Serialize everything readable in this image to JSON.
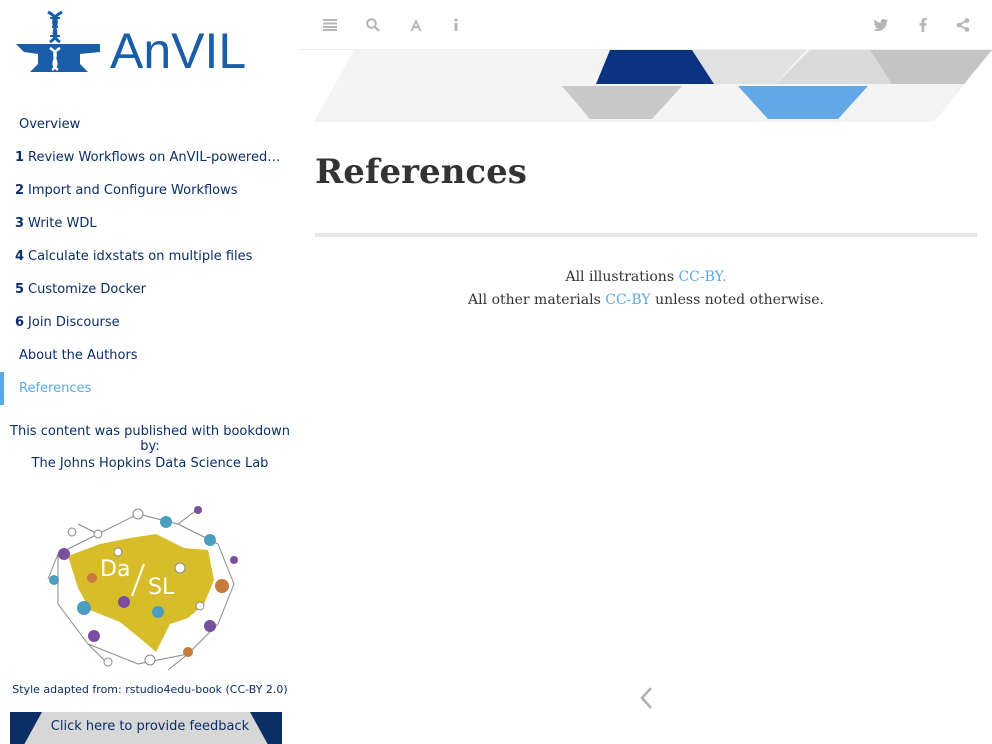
{
  "sidebar": {
    "logo_text": "AnVIL",
    "toc": [
      {
        "num": "",
        "label": "Overview"
      },
      {
        "num": "1",
        "label": "Review Workflows on AnVIL-powered-b…"
      },
      {
        "num": "2",
        "label": "Import and Configure Workflows"
      },
      {
        "num": "3",
        "label": "Write WDL"
      },
      {
        "num": "4",
        "label": "Calculate idxstats on multiple files"
      },
      {
        "num": "5",
        "label": "Customize Docker"
      },
      {
        "num": "6",
        "label": "Join Discourse"
      },
      {
        "num": "",
        "label": "About the Authors"
      },
      {
        "num": "",
        "label": "References"
      }
    ],
    "published_text": "This content was published with bookdown by:",
    "lab_name": "The Johns Hopkins Data Science Lab",
    "dasl_text": "DaSL",
    "style_adapted": "Style adapted from: rstudio4edu-book (CC-BY 2.0)",
    "feedback_text": "Click here to provide feedback"
  },
  "toolbar": {
    "icons": [
      "menu-icon",
      "search-icon",
      "font-icon",
      "info-icon",
      "twitter-icon",
      "facebook-icon",
      "share-icon"
    ]
  },
  "main": {
    "title": "References",
    "license_line1_prefix": "All illustrations ",
    "license_line1_link": "CC-BY.",
    "license_line2_prefix": "All other materials ",
    "license_line2_link": "CC-BY",
    "license_line2_suffix": " unless noted otherwise."
  },
  "colors": {
    "navy": "#0b2e67",
    "accent_blue": "#5aa9e6",
    "logo_blue": "#1a5da8",
    "banner_gray": "#c8c8c8"
  }
}
